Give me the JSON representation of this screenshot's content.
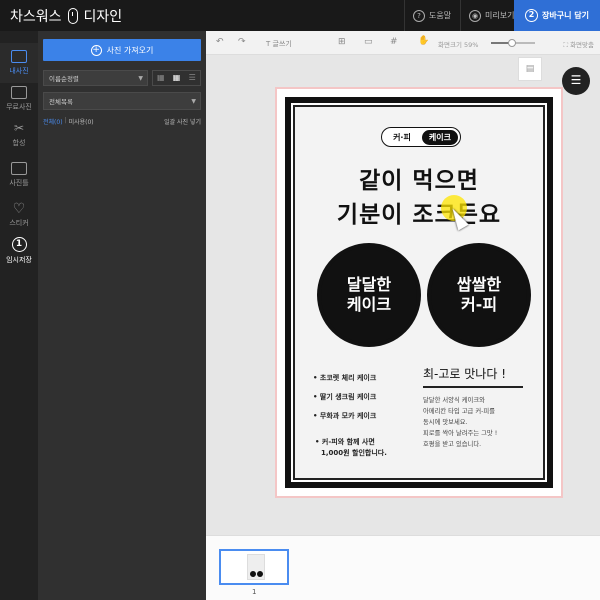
{
  "header": {
    "brand_left": "차스워스",
    "brand_right": "디자인",
    "help_label": "도움말",
    "preview_label": "미리보기",
    "cart_number": "2",
    "cart_label": "장바구니 담기"
  },
  "rail": {
    "items": [
      {
        "label": "내사진",
        "icon": "photo-icon"
      },
      {
        "label": "무료사진",
        "icon": "free-photo-icon"
      },
      {
        "label": "합성",
        "icon": "scissors-icon"
      },
      {
        "label": "사진틀",
        "icon": "frame-icon"
      },
      {
        "label": "스티커",
        "icon": "heart-icon"
      },
      {
        "number": "1",
        "label": "임시저장",
        "icon": "temp-save-icon"
      }
    ]
  },
  "panel": {
    "import_label": "사진 가져오기",
    "sort_value": "이름순정렬",
    "folder_value": "전체목록",
    "filter_all": "전체(0)",
    "filter_unused": "미사용(0)",
    "bulk_add": "일괄 사진 넣기"
  },
  "toolbar": {
    "text_label": "글쓰기",
    "zoom_label": "화면크기 59%",
    "zoom_value": 59,
    "fit_label": "화면맞춤"
  },
  "poster": {
    "pill_left": "커·피",
    "pill_right": "케이크",
    "headline_1": "같이 먹으면",
    "headline_2": "기분이 조크든요",
    "circle_1_line1": "달달한",
    "circle_1_line2": "케이크",
    "circle_2_line1": "쌉쌀한",
    "circle_2_line2": "커-피",
    "bullet_1": "• 초코렛 체리 케이크",
    "bullet_2": "• 딸기 생크림 케이크",
    "bullet_3": "• 무화과 모카 케이크",
    "note_line1": "• 커-피와 함께 사면",
    "note_line2": "1,000원 할인합니다.",
    "right_title": "최-고로 맛나다 !",
    "right_body_1": "달달한 서양식 케이크와",
    "right_body_2": "아메리칸 타입 고급 커-피를",
    "right_body_3": "동시에 맛보세요.",
    "right_body_4": "피로를 싹아 날려주는 그맛 !",
    "right_body_5": "호평을 받고 있습니다."
  },
  "pages": {
    "page_number": "1"
  }
}
